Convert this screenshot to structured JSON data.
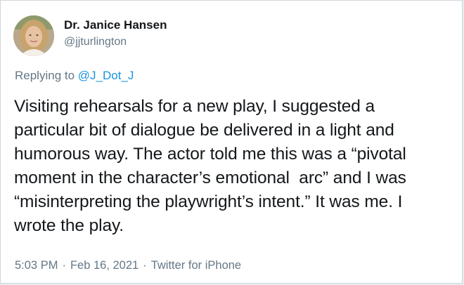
{
  "author": {
    "display_name": "Dr. Janice Hansen",
    "handle": "@jjturlington",
    "avatar": "profile-photo"
  },
  "reply": {
    "prefix": "Replying to ",
    "mention": "@J_Dot_J"
  },
  "tweet": {
    "text": "Visiting rehearsals for a new play, I suggested a\nparticular bit of dialogue be delivered in a light and\nhumorous way. The actor told me this was a “pivotal\nmoment in the character’s emotional  arc” and I was\n“misinterpreting the playwright’s intent.” It was me. I\nwrote the play."
  },
  "meta": {
    "time": "5:03 PM",
    "separator": "·",
    "date": "Feb 16, 2021",
    "source": "Twitter for iPhone"
  },
  "colors": {
    "link": "#1b95e0",
    "secondary_text": "#657786",
    "primary_text": "#14171a"
  }
}
